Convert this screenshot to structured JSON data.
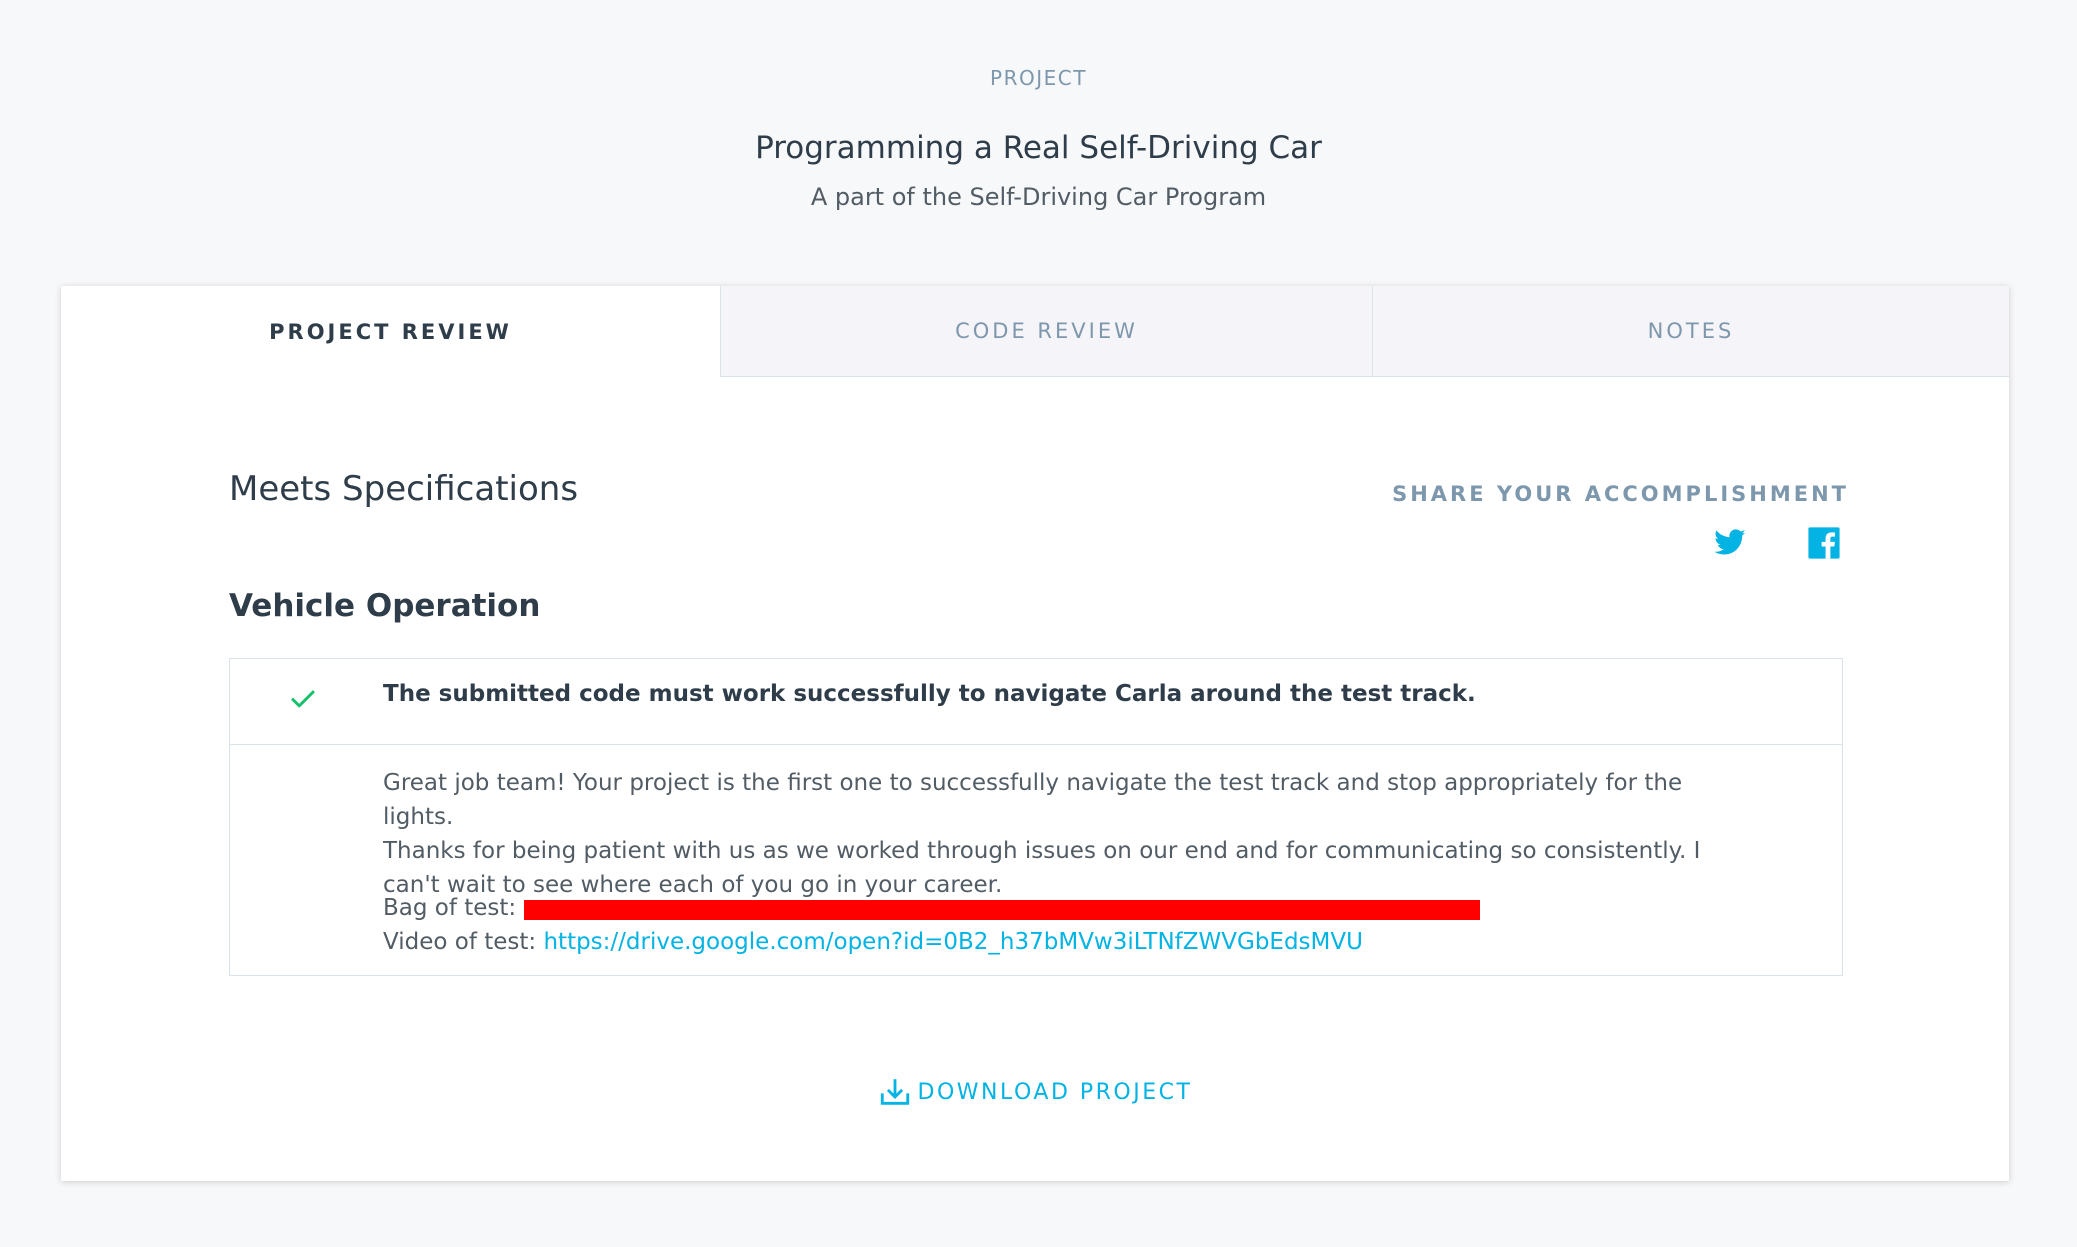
{
  "header": {
    "eyebrow": "PROJECT",
    "title": "Programming a Real Self-Driving Car",
    "subtitle": "A part of the Self-Driving Car Program"
  },
  "tabs": [
    {
      "label": "PROJECT REVIEW",
      "active": true
    },
    {
      "label": "CODE REVIEW",
      "active": false
    },
    {
      "label": "NOTES",
      "active": false
    }
  ],
  "review": {
    "status": "Meets Specifications",
    "share_label": "SHARE YOUR ACCOMPLISHMENT",
    "share_icons": [
      "twitter-icon",
      "facebook-icon"
    ],
    "section_title": "Vehicle Operation",
    "spec": {
      "status_icon": "check-icon",
      "text": "The submitted code must work successfully to navigate Carla around the test track.",
      "comment_lines": [
        "Great job team! Your project is the first one to successfully navigate the test track and stop appropriately for the lights.",
        "Thanks for being patient with us as we worked through issues on our end and for communicating so consistently. I",
        "can't wait to see where each of you go in your career."
      ],
      "bag_label": "Bag of test: ",
      "video_label": "Video of test: ",
      "video_url": "https://drive.google.com/open?id=0B2_h37bMVw3iLTNfZWVGbEdsMVU"
    }
  },
  "download": {
    "label": "DOWNLOAD PROJECT",
    "icon": "download-icon"
  },
  "colors": {
    "accent": "#02b3e4",
    "check": "#15c26b",
    "redaction": "#ff0000",
    "muted": "#7d97ad",
    "text": "#2e3d49"
  }
}
